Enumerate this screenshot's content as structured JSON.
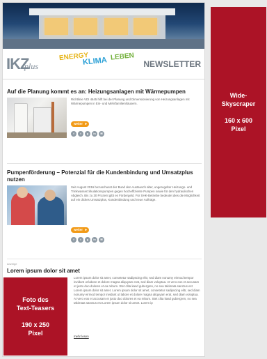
{
  "header": {
    "ikz": "IKZ",
    "plus": "plus",
    "energy": "ENERGY",
    "klima": "KLIMA",
    "leben": "LEBEN",
    "newsletter": "NEWSLETTER"
  },
  "articles": [
    {
      "title": "Auf die Planung kommt es an: Heizungsanlagen mit Wärmepumpen",
      "text": "Richtlinie VDI 4645 hilft bei der Planung und Dimensionierung von Heizungsanlagen mit Wärmepumpen in Ein- und Mehrfamilienhäusern.",
      "more_label": "weiter",
      "social": [
        "f",
        "t",
        "g",
        "in",
        "✉"
      ]
    },
    {
      "title": "Pumpenförderung – Potenzial für die Kundenbindung und Umsatzplus nutzen",
      "text": "Seit August 2016 bezuschusst der Bund den Austausch alter, ungeregelter Heizungs- und Trinkwasserzirkulationspumpen gegen hocheffiziente Pumpen sowie für den hydraulischen Abgleich. Bis zu 30 Prozent gibt es Fördergeld. Für SHK-Betriebe bedeutet dies die Möglichkeit auf ein dickes Umsatzplus, Kundenbindung und neue Aufträge.",
      "more_label": "weiter",
      "social": [
        "f",
        "t",
        "g",
        "in",
        "✉"
      ]
    },
    {
      "kicker": "Anzeige",
      "title": "Lorem ipsum dolor sit amet",
      "text": "Lorem ipsum dolor sit amet, consetetur sadipscing elitr, sed diam nonumy eirmod tempor invidunt ut labore et dolore magna aliquyam erat, sed diam voluptua. At vero eos et accusam et justo duo dolores et ea rebum. Stet clita kasd gubergren, no sea takimata sanctus est Lorem ipsum dolor sit amet. Lorem ipsum dolor sit amet, consetetur sadipscing elitr, sed diam nonumy eirmod tempor invidunt ut labore et dolore magna aliquyam erat, sed diam voluptua. At vero eos et accusam et justo duo dolores et ea rebum. Stet clita kasd gubergren, no sea takimata sanctus est Lorem ipsum dolor sit amet. Lorem ip",
      "more_label": "mehr lesen"
    }
  ],
  "ads": {
    "skyscraper": [
      "Wide-",
      "Skyscraper",
      "160 x 600",
      "Pixel"
    ],
    "teaser": [
      "Foto des",
      "Text-Teasers",
      "190 x 250",
      "Pixel"
    ]
  },
  "colors": {
    "ad_red": "#ac1326",
    "orange": "#f29a16"
  }
}
